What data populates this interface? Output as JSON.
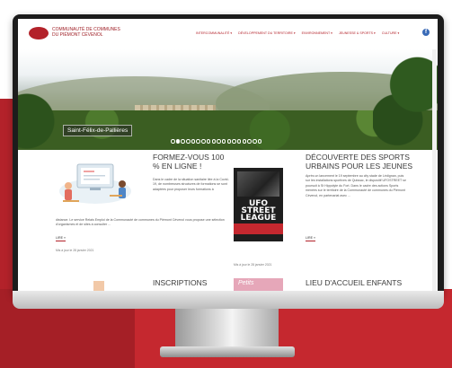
{
  "header": {
    "site_title_line1": "COMMUNAUTÉ DE COMMUNES",
    "site_title_line2": "DU PIÉMONT CÉVENOL",
    "nav": [
      "INTERCOMMUNALITÉ ▾",
      "DÉVELOPPEMENT DU TERRITOIRE ▾",
      "ENVIRONNEMENT ▾",
      "JEUNESSE & SPORTS ▾",
      "CULTURE ▾"
    ],
    "facebook": "f"
  },
  "hero": {
    "caption": "Saint-Félix-de-Pallières",
    "slide_count": 18,
    "active_slide": 1
  },
  "articles": [
    {
      "title": "FORMEZ-VOUS 100 % EN LIGNE !",
      "body_a": "Dans le cadre de la situation sanitaire liée à la Covid-19, de nombreuses structures de formations se sont adaptées pour proposer leurs formations à",
      "body_b": "distance. Le service Relais Emploi de la Communauté de communes du Piémont Cévenol vous propose une sélection d'organismes et de sites à consulter ...",
      "more": "LIRE »",
      "date": "Mis à jour le 28 janvier 2021"
    },
    {
      "title": "DÉCOUVERTE DES SPORTS URBAINS POUR LES JEUNES",
      "body": "Après un lancement le 19 septembre au city stade de Lédignan, puis sur les installations sportives de Quissac, le dispositif UFOSTREET se poursuit à St Hippolyte du Fort. Dans le cadre des actions Sports menées sur le territoire de la Communauté de communes du Piémont Cévenol, en partenariat avec ...",
      "more": "LIRE »",
      "date": "Mis à jour le 28 janvier 2021",
      "poster_text": "UFO STREET LEAGUE"
    }
  ],
  "next_row": {
    "title_left": "INSCRIPTIONS",
    "pink_label": "Petits",
    "title_right": "LIEU D'ACCUEIL ENFANTS"
  },
  "colors": {
    "brand_red": "#b3222a",
    "accent_red": "#c5282f"
  }
}
